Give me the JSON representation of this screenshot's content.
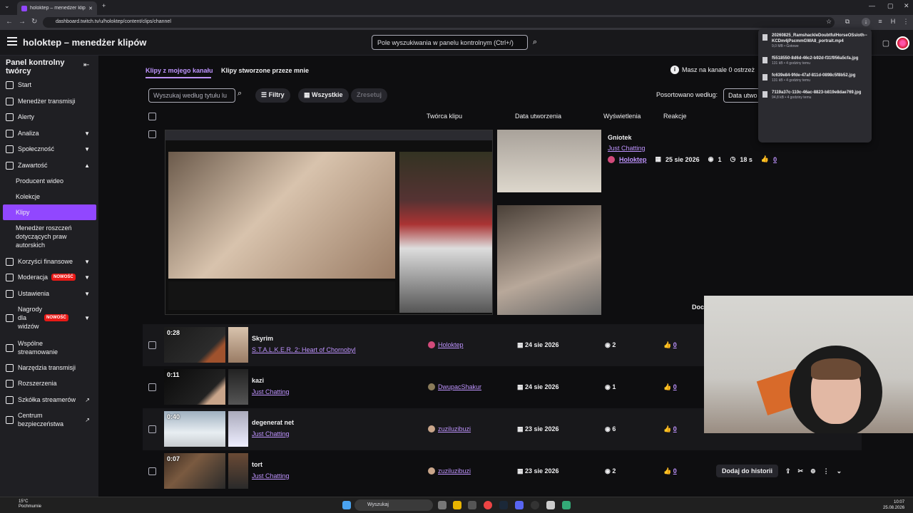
{
  "browser": {
    "tab_title": "holoktep – menedżer klipów -",
    "url": "dashboard.twitch.tv/u/holoktep/content/clips/channel"
  },
  "header": {
    "title": "holoktep – menedżer klipów",
    "search_placeholder": "Pole wyszukiwania w panelu kontrolnym (Ctrl+/)"
  },
  "sidebar": {
    "title": "Panel kontrolny twórcy",
    "items": [
      {
        "label": "Start",
        "icon": "home-icon"
      },
      {
        "label": "Menedżer transmisji",
        "icon": "broadcast-icon"
      },
      {
        "label": "Alerty",
        "icon": "alert-icon"
      },
      {
        "label": "Analiza",
        "icon": "analytics-icon",
        "chevron": "down"
      },
      {
        "label": "Społeczność",
        "icon": "community-icon",
        "chevron": "down"
      },
      {
        "label": "Zawartość",
        "icon": "content-icon",
        "chevron": "up"
      },
      {
        "label": "Producent wideo",
        "sub": true
      },
      {
        "label": "Kolekcje",
        "sub": true
      },
      {
        "label": "Klipy",
        "sub": true,
        "active": true
      },
      {
        "label": "Menedżer roszczeń dotyczących praw autorskich",
        "sub": true
      },
      {
        "label": "Korzyści finansowe",
        "icon": "money-icon",
        "chevron": "down"
      },
      {
        "label": "Moderacja",
        "icon": "shield-icon",
        "chevron": "down",
        "badge": "NOWOŚĆ"
      },
      {
        "label": "Ustawienia",
        "icon": "gear-icon",
        "chevron": "down"
      },
      {
        "label": "Nagrody dla widzów",
        "icon": "reward-icon",
        "chevron": "down",
        "badge": "NOWOŚĆ"
      },
      {
        "label": "Wspólne streamowanie",
        "icon": "users-icon"
      },
      {
        "label": "Narzędzia transmisji",
        "icon": "tools-icon"
      },
      {
        "label": "Rozszerzenia",
        "icon": "extensions-icon"
      },
      {
        "label": "Szkółka streamerów",
        "icon": "school-icon",
        "external": true
      },
      {
        "label": "Centrum bezpieczeństwa",
        "icon": "safety-icon",
        "external": true
      }
    ]
  },
  "content": {
    "tabs": [
      "Klipy z mojego kanału",
      "Klipy stworzone przeze mnie"
    ],
    "info_text": "Masz na kanale 0 ostrzeż",
    "filter_placeholder": "Wyszukaj według tytułu lu",
    "filters_label": "Filtry",
    "all_label": "Wszystkie",
    "reset_label": "Zresetuj",
    "sort_label": "Posortowano według:",
    "sort_value": "Data utwo",
    "columns": {
      "creator": "Twórca klipu",
      "date": "Data utworzenia",
      "views": "Wyświetlenia",
      "reactions": "Reakcje"
    },
    "expanded": {
      "title": "Gniotek",
      "game": "Just Chatting",
      "creator": "Holoktep",
      "date": "25 sie 2026",
      "views": "1",
      "duration": "18 s",
      "likes": "0",
      "add_button": "Doc"
    },
    "rows": [
      {
        "duration": "0:28",
        "title": "Skyrim",
        "game": "S.T.A.L.K.E.R. 2: Heart of Chornobyl",
        "creator": "Holoktep",
        "date": "24 sie 2026",
        "views": "2",
        "likes": "0"
      },
      {
        "duration": "0:11",
        "title": "kazi",
        "game": "Just Chatting",
        "creator": "DwupacShakur",
        "date": "24 sie 2026",
        "views": "1",
        "likes": "0"
      },
      {
        "duration": "0:40",
        "title": "degenerat net",
        "game": "Just Chatting",
        "creator": "zuziluzibuzi",
        "date": "23 sie 2026",
        "views": "6",
        "likes": "0"
      },
      {
        "duration": "0:07",
        "title": "tort",
        "game": "Just Chatting",
        "creator": "zuziluzibuzi",
        "date": "23 sie 2026",
        "views": "2",
        "likes": "0",
        "add_button": "Dodaj do historii"
      }
    ]
  },
  "downloads": [
    {
      "name": "20260825_RamshackleDoubtfulHorseOSsloth--KCDm4jPscmmGWA8_portrait.mp4",
      "status": "9,0 MB • Gotowe"
    },
    {
      "name": "f5518550-8d6d-46c2-b92d-f31f956a5cfa.jpg",
      "status": "131 kB • 4 godziny temu"
    },
    {
      "name": "fc639e84-9fde-47af-811d-0898c5f8b52.jpg",
      "status": "131 kB • 4 godziny temu"
    },
    {
      "name": "7119a37c-110c-46ac-8823-b819e8dae769.jpg",
      "status": "94,8 kB • 4 godziny temu"
    }
  ],
  "taskbar": {
    "weather_temp": "15°C",
    "weather_desc": "Pochmurnie",
    "search": "Wyszukaj",
    "time": "10:07",
    "date": "25.08.2026"
  }
}
